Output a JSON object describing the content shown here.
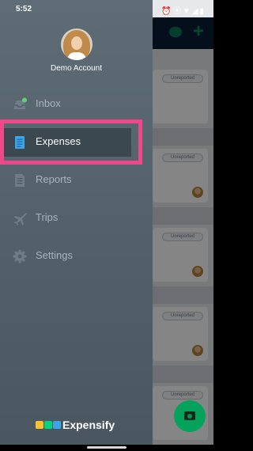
{
  "status_bar": {
    "time": "5:52",
    "icons": [
      "alarm-icon",
      "vibrate-icon",
      "wifi-icon",
      "signal-icon",
      "battery-icon"
    ]
  },
  "drawer": {
    "account_name": "Demo Account",
    "menu": [
      {
        "label": "Inbox",
        "icon": "inbox-icon",
        "active": false
      },
      {
        "label": "Expenses",
        "icon": "receipt-icon",
        "active": true
      },
      {
        "label": "Reports",
        "icon": "report-icon",
        "active": false
      },
      {
        "label": "Trips",
        "icon": "plane-icon",
        "active": false
      },
      {
        "label": "Settings",
        "icon": "gear-icon",
        "active": false
      }
    ],
    "brand": "Expensify"
  },
  "background": {
    "badge_label": "Unreported",
    "cards": 5
  },
  "colors": {
    "drawer_top": "#5e6c76",
    "drawer_bottom": "#4a5660",
    "highlight": "#f0478b",
    "brand_green": "#03d47c",
    "inbox_dot": "#5ad56b",
    "expenses_icon": "#3ba5e8"
  }
}
